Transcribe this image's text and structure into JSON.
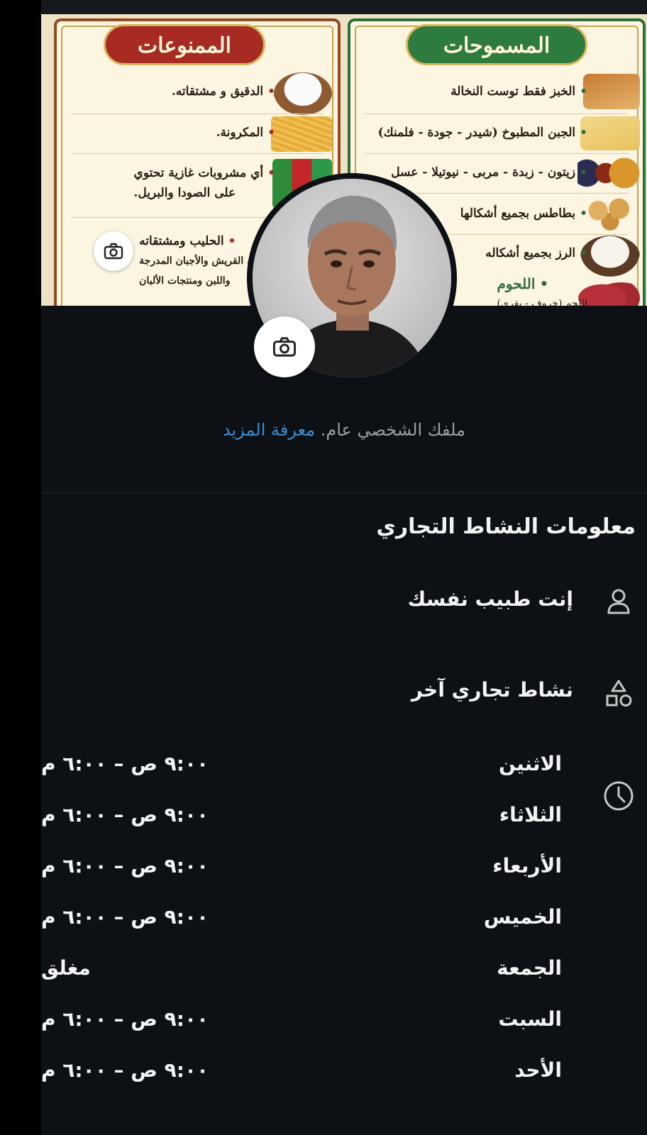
{
  "cover": {
    "allowed_title": "المسموحات",
    "forbidden_title": "الممنوعات",
    "allowed_items": [
      {
        "text": "الخبز فقط توست النخالة"
      },
      {
        "text": "الجبن المطبوخ (شيدر - جودة - فلمنك)"
      },
      {
        "text": "زيتون - زبدة - مربى - نيوتيلا - عسل"
      },
      {
        "text": "بطاطس بجميع أشكالها"
      },
      {
        "text": "الرز بجميع أشكاله"
      },
      {
        "text": "اللحوم",
        "sub": "اللحم (خروف - بقري)"
      }
    ],
    "forbidden_items": [
      {
        "text": "الدقيق و مشتقاته."
      },
      {
        "text": "المكرونة."
      },
      {
        "line1": "أي مشروبات غازية تحتوي",
        "line2": "على الصودا والبريل."
      },
      {
        "line1": "الحليب ومشتقاته",
        "line2": "والجبنة القريش والأجبان المدرجة",
        "line3": "واللبن ومنتجات الألبان"
      }
    ],
    "bullet": "•",
    "colors": {
      "allowed": "#2e7b3f",
      "forbidden": "#a72b23",
      "parchment": "#fbf5e2"
    }
  },
  "icons": {
    "cover_camera": "camera-icon",
    "avatar_camera": "camera-icon",
    "person": "person-icon",
    "shapes": "category-shapes-icon",
    "clock": "clock-icon"
  },
  "profile": {
    "public_note": "ملفك الشخصي عام.",
    "learn_more": "معرفة المزيد"
  },
  "business": {
    "section_title": "معلومات النشاط التجاري",
    "category": "إنت طبيب نفسك",
    "type": "نشاط تجاري آخر",
    "hours": [
      {
        "day": "الاثنين",
        "time": "٩:٠٠ ص – ٦:٠٠ م"
      },
      {
        "day": "الثلاثاء",
        "time": "٩:٠٠ ص – ٦:٠٠ م"
      },
      {
        "day": "الأربعاء",
        "time": "٩:٠٠ ص – ٦:٠٠ م"
      },
      {
        "day": "الخميس",
        "time": "٩:٠٠ ص – ٦:٠٠ م"
      },
      {
        "day": "الجمعة",
        "time": "مغلق"
      },
      {
        "day": "السبت",
        "time": "٩:٠٠ ص – ٦:٠٠ م"
      },
      {
        "day": "الأحد",
        "time": "٩:٠٠ ص – ٦:٠٠ م"
      }
    ]
  }
}
